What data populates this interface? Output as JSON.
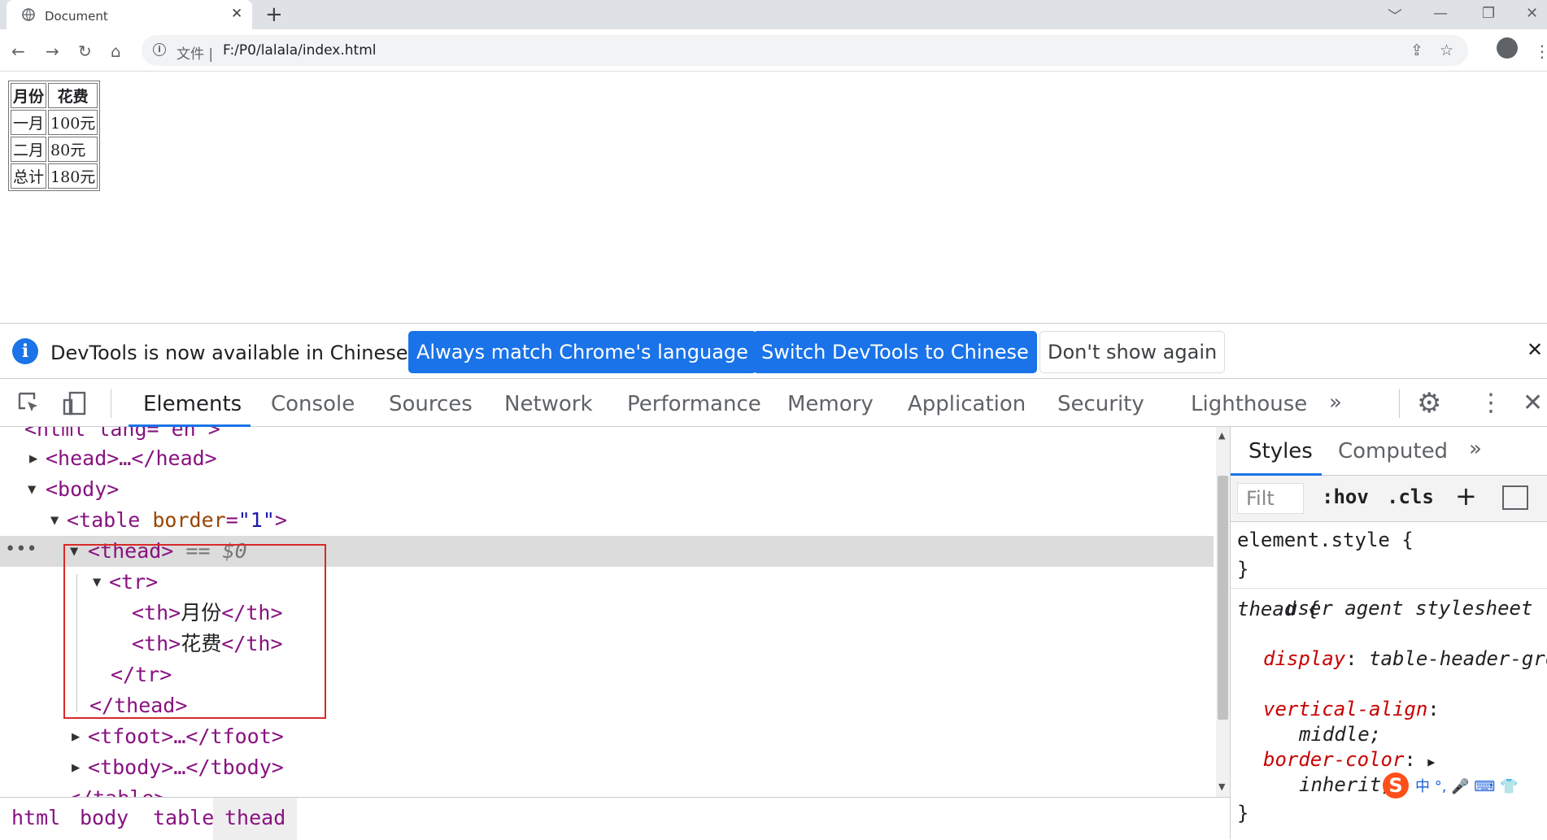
{
  "browser": {
    "tab_title": "Document",
    "tab_close": "✕",
    "new_tab": "+",
    "window_controls": [
      "﹀",
      "—",
      "❐",
      "✕"
    ],
    "omnibox": {
      "file_label": "文件 |",
      "url": "F:/P0/lalala/index.html"
    }
  },
  "page": {
    "table": {
      "headers": [
        "月份",
        "花费"
      ],
      "rows": [
        [
          "一月",
          "100元"
        ],
        [
          "二月",
          "80元"
        ],
        [
          "总计",
          "180元"
        ]
      ]
    }
  },
  "infobar": {
    "message": "DevTools is now available in Chinese!",
    "btn_match": "Always match Chrome's language",
    "btn_switch": "Switch DevTools to Chinese",
    "btn_dismiss": "Don't show again"
  },
  "devtools": {
    "tabs": [
      "Elements",
      "Console",
      "Sources",
      "Network",
      "Performance",
      "Memory",
      "Application",
      "Security",
      "Lighthouse"
    ],
    "active_tab": "Elements",
    "dom": {
      "html_open": "<html lang=\"en\">",
      "head": "<head>…</head>",
      "body": "<body>",
      "table_tag": "<table",
      "table_attr": "border",
      "table_val": "\"1\"",
      "thead": "<thead>",
      "thead_marker": "== $0",
      "tr_open": "<tr>",
      "th1_open": "<th>",
      "th1_text": "月份",
      "th1_close": "</th>",
      "th2_open": "<th>",
      "th2_text": "花费",
      "th2_close": "</th>",
      "tr_close": "</tr>",
      "thead_close": "</thead>",
      "tfoot": "<tfoot>…</tfoot>",
      "tbody": "<tbody>…</tbody>",
      "table_close": "</table>"
    },
    "breadcrumbs": [
      "html",
      "body",
      "table",
      "thead"
    ],
    "styles": {
      "tabs": [
        "Styles",
        "Computed"
      ],
      "filter_placeholder": "Filt",
      "hov": ":hov",
      "cls": ".cls",
      "element_style": "element.style {",
      "close_brace": "}",
      "ua_selector": "thead {",
      "ua_source": "user agent stylesheet",
      "declarations": [
        {
          "prop": "display",
          "value": "table-header-group;"
        },
        {
          "prop": "vertical-align",
          "value": "middle;"
        },
        {
          "prop": "border-color",
          "value": "inherit;"
        }
      ]
    },
    "ime_glyphs": "中 °, 🎤 ⌨ 👕"
  },
  "colors": {
    "accent": "#1a73e8",
    "tag": "#881280",
    "attr": "#994500",
    "value": "#1a1aa6",
    "highlight_border": "#d92929"
  }
}
